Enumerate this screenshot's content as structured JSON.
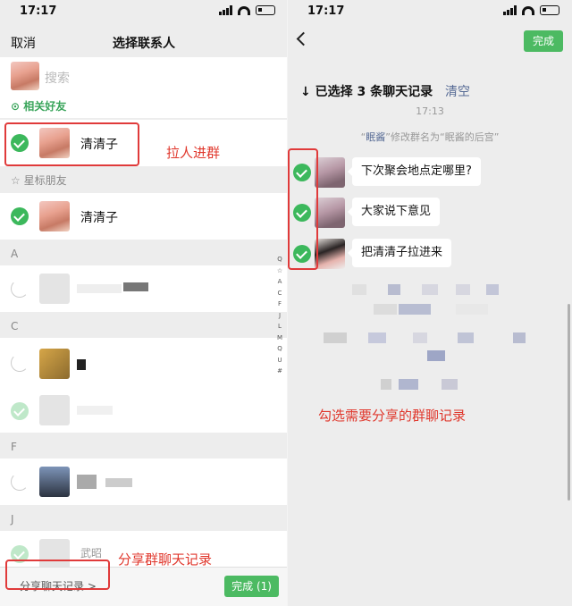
{
  "status": {
    "time": "17:17"
  },
  "left": {
    "cancel": "取消",
    "title": "选择联系人",
    "search_placeholder": "搜索",
    "related_friends": "相关好友",
    "starred_friends": "星标朋友",
    "contact_name": "清清子",
    "letters": [
      "A",
      "C",
      "F",
      "J"
    ],
    "index": [
      "Q",
      "☆",
      "A",
      "C",
      "F",
      "J",
      "L",
      "M",
      "Q",
      "U",
      "#"
    ],
    "partial_name": "武昭",
    "share_chat": "分享聊天记录 >",
    "done": "完成 (1)",
    "annotation_invite": "拉人进群",
    "annotation_share": "分享群聊天记录"
  },
  "right": {
    "done": "完成",
    "selected": "↓  已选择 3 条聊天记录",
    "clear": "清空",
    "time": "17:13",
    "system_name": "眠酱",
    "system_msg_1": "“",
    "system_msg_2": "”修改群名为“眠酱的后宫”",
    "messages": [
      "下次聚会地点定哪里?",
      "大家说下意见",
      "把清清子拉进来"
    ],
    "annotation_check": "勾选需要分享的群聊记录"
  },
  "colors": {
    "green": "#3cb85c",
    "annotation_red": "#e0372c",
    "link_blue": "#576b95"
  }
}
